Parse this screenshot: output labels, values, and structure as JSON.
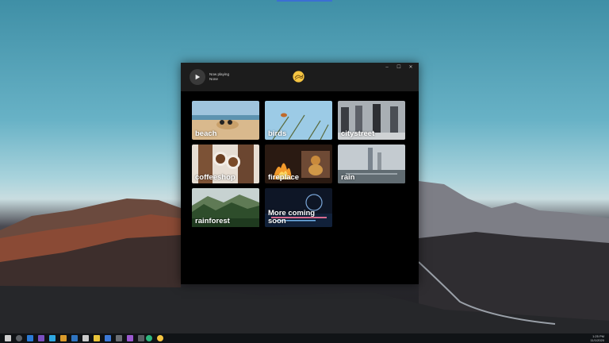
{
  "app": {
    "now_playing_label": "Now playing",
    "now_playing_value": "None",
    "window_controls": [
      "–",
      "☐",
      "✕"
    ]
  },
  "sounds": [
    {
      "label": "beach"
    },
    {
      "label": "birds"
    },
    {
      "label": "citystreet"
    },
    {
      "label": "coffeeshop"
    },
    {
      "label": "fireplace"
    },
    {
      "label": "rain"
    },
    {
      "label": "rainforest"
    },
    {
      "label": "More coming soon"
    }
  ],
  "taskbar": {
    "time": "1:25 PM",
    "date": "11/1/2020"
  },
  "colors": {
    "window_bg": "#000000",
    "titlebar_bg": "#1c1c1c",
    "taskbar_bg": "#101316",
    "logo_yellow": "#f5c542"
  }
}
